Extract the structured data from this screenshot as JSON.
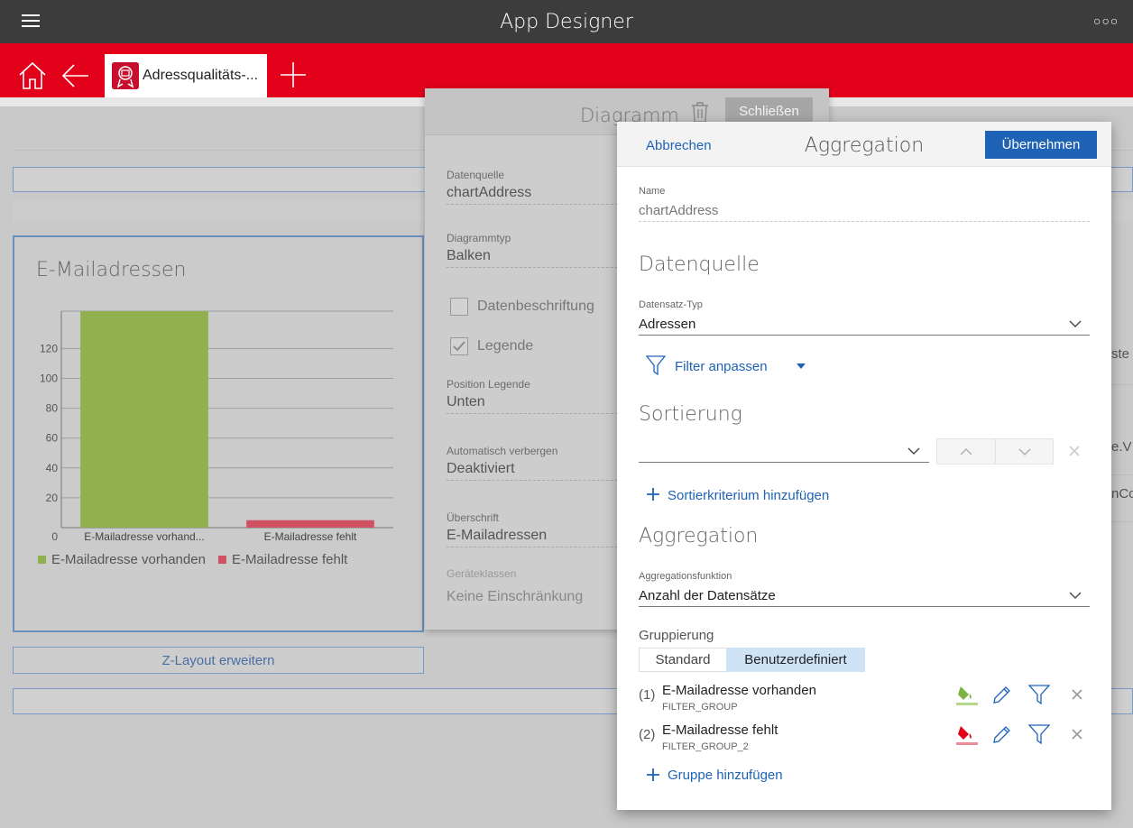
{
  "app": {
    "title": "App Designer"
  },
  "tabs": {
    "active_label": "Adressqualitäts-..."
  },
  "canvas": {
    "chart_title": "E-Mailadressen",
    "zlayout_label": "Z-Layout erweitern",
    "right_fragments": [
      "ste",
      "e.V",
      "nCo"
    ]
  },
  "chart_data": {
    "type": "bar",
    "title": "E-Mailadressen",
    "categories": [
      "E-Mailadresse vorhand...",
      "E-Mailadresse fehlt"
    ],
    "series": [
      {
        "name": "E-Mailadresse vorhanden",
        "values": [
          145
        ],
        "color": "#92b050"
      },
      {
        "name": "E-Mailadresse fehlt",
        "values": [
          5
        ],
        "color": "#d05262"
      }
    ],
    "y_ticks": [
      0,
      20,
      40,
      60,
      80,
      100,
      120
    ],
    "ylim": [
      0,
      145
    ],
    "grid": true,
    "legend_position": "bottom"
  },
  "diagramm": {
    "title": "Diagramm",
    "close_label": "Schließen",
    "fields": [
      {
        "label": "Datenquelle",
        "value": "chartAddress"
      },
      {
        "label": "Diagrammtyp",
        "value": "Balken"
      },
      {
        "label": "Position Legende",
        "value": "Unten"
      },
      {
        "label": "Automatisch verbergen",
        "value": "Deaktiviert"
      },
      {
        "label": "Überschrift",
        "value": "E-Mailadressen"
      },
      {
        "label": "Geräteklassen",
        "value": "Keine Einschränkung"
      }
    ],
    "checkboxes": [
      {
        "label": "Datenbeschriftung",
        "checked": false
      },
      {
        "label": "Legende",
        "checked": true
      }
    ]
  },
  "aggregation": {
    "cancel_label": "Abbrechen",
    "title": "Aggregation",
    "apply_label": "Übernehmen",
    "name_label": "Name",
    "name_value": "chartAddress",
    "datasource_heading": "Datenquelle",
    "record_type_label": "Datensatz-Typ",
    "record_type_value": "Adressen",
    "filter_label": "Filter anpassen",
    "sort_heading": "Sortierung",
    "add_sort_label": "Sortierkriterium hinzufügen",
    "agg_heading": "Aggregation",
    "agg_func_label": "Aggregationsfunktion",
    "agg_func_value": "Anzahl der Datensätze",
    "grouping_label": "Gruppierung",
    "grouping_tabs": [
      "Standard",
      "Benutzerdefiniert"
    ],
    "groups": [
      {
        "num": "(1)",
        "name": "E-Mailadresse vorhanden",
        "sub": "FILTER_GROUP",
        "color": "#7cb342"
      },
      {
        "num": "(2)",
        "name": "E-Mailadresse fehlt",
        "sub": "FILTER_GROUP_2",
        "color": "#e2001a"
      }
    ],
    "add_group_label": "Gruppe hinzufügen"
  }
}
